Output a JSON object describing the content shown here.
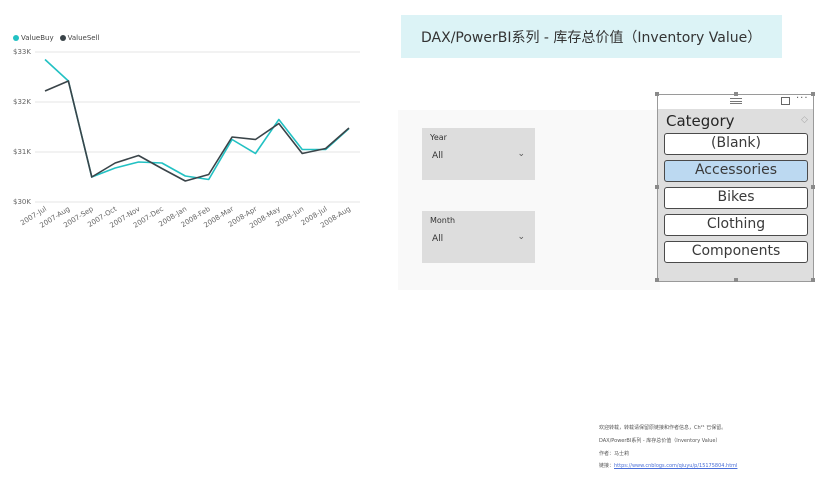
{
  "title": "DAX/PowerBI系列 - 库存总价值（Inventory Value）",
  "colors": {
    "buy": "#22c1c3",
    "sell": "#3a4449",
    "title_bg": "#dcf3f6",
    "selected": "#bcd9f1"
  },
  "chart_data": {
    "type": "line",
    "categories": [
      "2007-Jul",
      "2007-Aug",
      "2007-Sep",
      "2007-Oct",
      "2007-Nov",
      "2007-Dec",
      "2008-Jan",
      "2008-Feb",
      "2008-Mar",
      "2008-Apr",
      "2008-May",
      "2008-Jun",
      "2008-Jul",
      "2008-Aug"
    ],
    "series": [
      {
        "name": "ValueBuy",
        "values": [
          32.85,
          32.42,
          30.5,
          30.68,
          30.8,
          30.78,
          30.52,
          30.45,
          31.25,
          30.97,
          31.65,
          31.05,
          31.05,
          31.47
        ]
      },
      {
        "name": "ValueSell",
        "values": [
          32.22,
          32.42,
          30.5,
          30.78,
          30.93,
          30.67,
          30.42,
          30.55,
          31.3,
          31.25,
          31.57,
          30.97,
          31.07,
          31.48
        ]
      }
    ],
    "ylim": [
      30,
      33
    ],
    "yticks": [
      "$30K",
      "$31K",
      "$32K",
      "$33K"
    ],
    "grid": true,
    "legend": "top-left"
  },
  "slicers": [
    {
      "label": "Year",
      "value": "All"
    },
    {
      "label": "Month",
      "value": "All"
    }
  ],
  "category_slicer": {
    "title": "Category",
    "items": [
      {
        "label": "(Blank)",
        "selected": false
      },
      {
        "label": "Accessories",
        "selected": true
      },
      {
        "label": "Bikes",
        "selected": false
      },
      {
        "label": "Clothing",
        "selected": false
      },
      {
        "label": "Components",
        "selected": false
      }
    ]
  },
  "footer": {
    "line1": "欢迎转载，转载请保留原链接和作者信息，Ch²¹ 已保留。",
    "line2": "DAX/PowerBI系列 - 库存总价值（Inventory Value）",
    "line3": "作者：马士莉",
    "line4_prefix": "链接：",
    "line4_link": "https://www.cnblogs.com/qiuyu/p/15175804.html"
  }
}
